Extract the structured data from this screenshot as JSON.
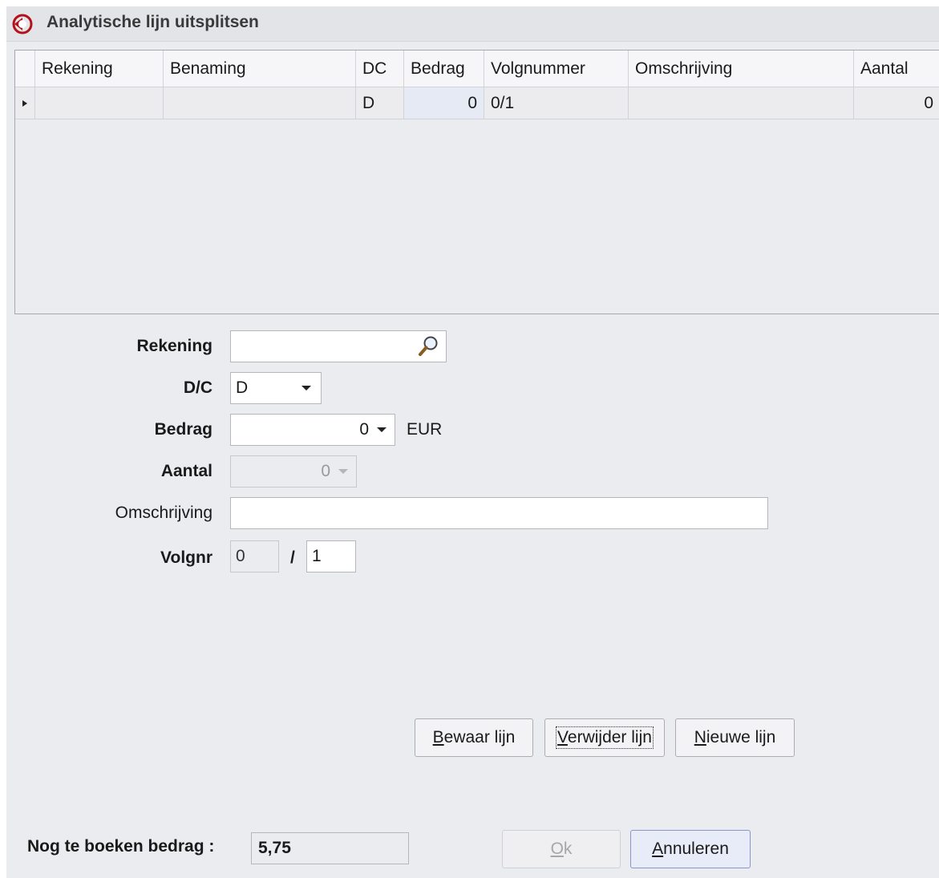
{
  "window": {
    "title": "Analytische lijn uitsplitsen",
    "app_icon": "app-logo-icon"
  },
  "grid": {
    "columns": [
      "Rekening",
      "Benaming",
      "DC",
      "Bedrag",
      "Volgnummer",
      "Omschrijving",
      "Aantal"
    ],
    "rows": [
      {
        "rekening": "",
        "benaming": "",
        "dc": "D",
        "bedrag": "0",
        "volgnummer": "0/1",
        "omschrijving": "",
        "aantal": "0"
      }
    ]
  },
  "form": {
    "rekening": {
      "label": "Rekening",
      "value": ""
    },
    "dc": {
      "label": "D/C",
      "value": "D"
    },
    "bedrag": {
      "label": "Bedrag",
      "value": "0",
      "unit": "EUR"
    },
    "aantal": {
      "label": "Aantal",
      "value": "0"
    },
    "omschrijving": {
      "label": "Omschrijving",
      "value": ""
    },
    "volgnr": {
      "label": "Volgnr",
      "value": "0",
      "separator": "/",
      "total": "1"
    }
  },
  "buttons": {
    "bewaar": {
      "underlined": "B",
      "rest": "ewaar lijn"
    },
    "verwijder": {
      "underlined": "V",
      "rest": "erwijder lijn"
    },
    "nieuwe": {
      "underlined": "N",
      "rest": "ieuwe lijn"
    },
    "ok": {
      "underlined": "O",
      "rest": "k"
    },
    "annuleren": {
      "underlined": "A",
      "rest": "nnuleren"
    }
  },
  "footer": {
    "remaining_label": "Nog te boeken bedrag :",
    "remaining_value": "5,75"
  }
}
